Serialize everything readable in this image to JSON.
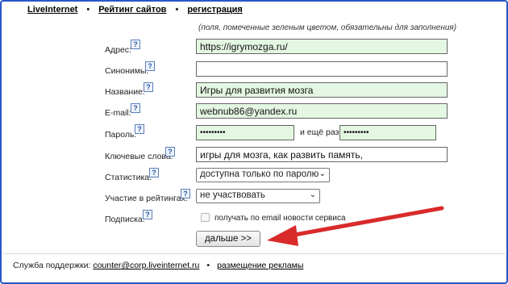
{
  "nav": {
    "links": [
      "LiveInternet",
      "Рейтинг сайтов",
      "регистрация"
    ],
    "separator": "•"
  },
  "note": "(поля, помеченные зеленым цветом, обязательны для заполнения)",
  "help_icon": "?",
  "form": {
    "address": {
      "label": "Адрес:",
      "value": "https://igrymozga.ru/"
    },
    "synonyms": {
      "label": "Синонимы:",
      "value": ""
    },
    "name": {
      "label": "Название:",
      "value": "Игры для развития мозга"
    },
    "email": {
      "label": "E-mail:",
      "value": "webnub86@yandex.ru"
    },
    "password": {
      "label": "Пароль:",
      "value": "•••••••••",
      "repeat_label": "и ещё раз:",
      "repeat_value": "•••••••••"
    },
    "keywords": {
      "label": "Ключевые слова:",
      "value": "игры для мозга, как развить память,"
    },
    "stats": {
      "label": "Статистика:",
      "selected": "доступна только по паролю"
    },
    "rating": {
      "label": "Участие в рейтингах:",
      "selected": "не участвовать"
    },
    "subscription": {
      "label": "Подписка:",
      "checkbox_label": "получать по email новости сервиса",
      "checked": false
    },
    "submit_label": "дальше >>"
  },
  "colors": {
    "required_field": "#e4f7e2",
    "frame": "#2a56c6",
    "arrow": "#d92b2b"
  },
  "footer": {
    "support_label": "Служба поддержки:",
    "support_email": "counter@corp.liveinternet.ru",
    "separator": "•",
    "ads_link": "размещение рекламы"
  }
}
